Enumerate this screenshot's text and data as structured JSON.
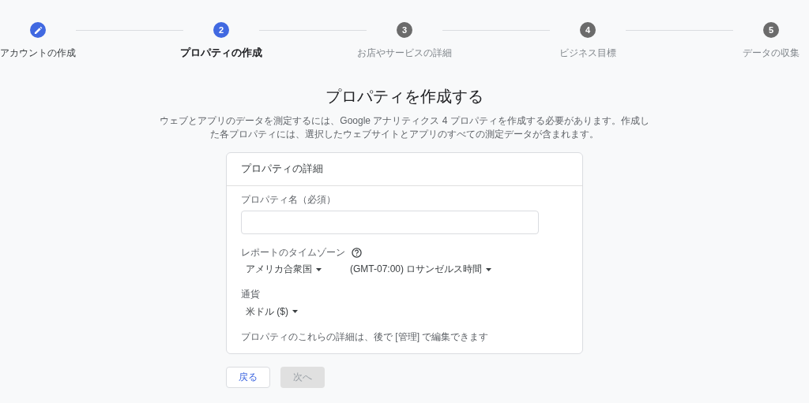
{
  "steps": [
    {
      "label": "アカウントの作成",
      "completed": true,
      "selected": false
    },
    {
      "number": "2",
      "label": "プロパティの作成",
      "completed": false,
      "selected": true
    },
    {
      "number": "3",
      "label": "お店やサービスの詳細",
      "completed": false,
      "selected": false
    },
    {
      "number": "4",
      "label": "ビジネス目標",
      "completed": false,
      "selected": false
    },
    {
      "number": "5",
      "label": "データの収集",
      "completed": false,
      "selected": false
    }
  ],
  "title": "プロパティを作成する",
  "description": "ウェブとアプリのデータを測定するには、Google アナリティクス 4 プロパティを作成する必要があります。作成した各プロパティには、選択したウェブサイトとアプリのすべての測定データが含まれます。",
  "card": {
    "title": "プロパティの詳細",
    "property_name": {
      "label": "プロパティ名（必須）"
    },
    "timezone": {
      "label": "レポートのタイムゾーン",
      "country": "アメリカ合衆国",
      "zone": "(GMT-07:00) ロサンゼルス時間"
    },
    "currency": {
      "label": "通貨",
      "value": "米ドル ($)"
    },
    "note": "プロパティのこれらの詳細は、後で [管理] で編集できます"
  },
  "buttons": [
    {
      "label": "戻る",
      "disabled": false
    },
    {
      "label": "次へ",
      "disabled": true
    }
  ]
}
